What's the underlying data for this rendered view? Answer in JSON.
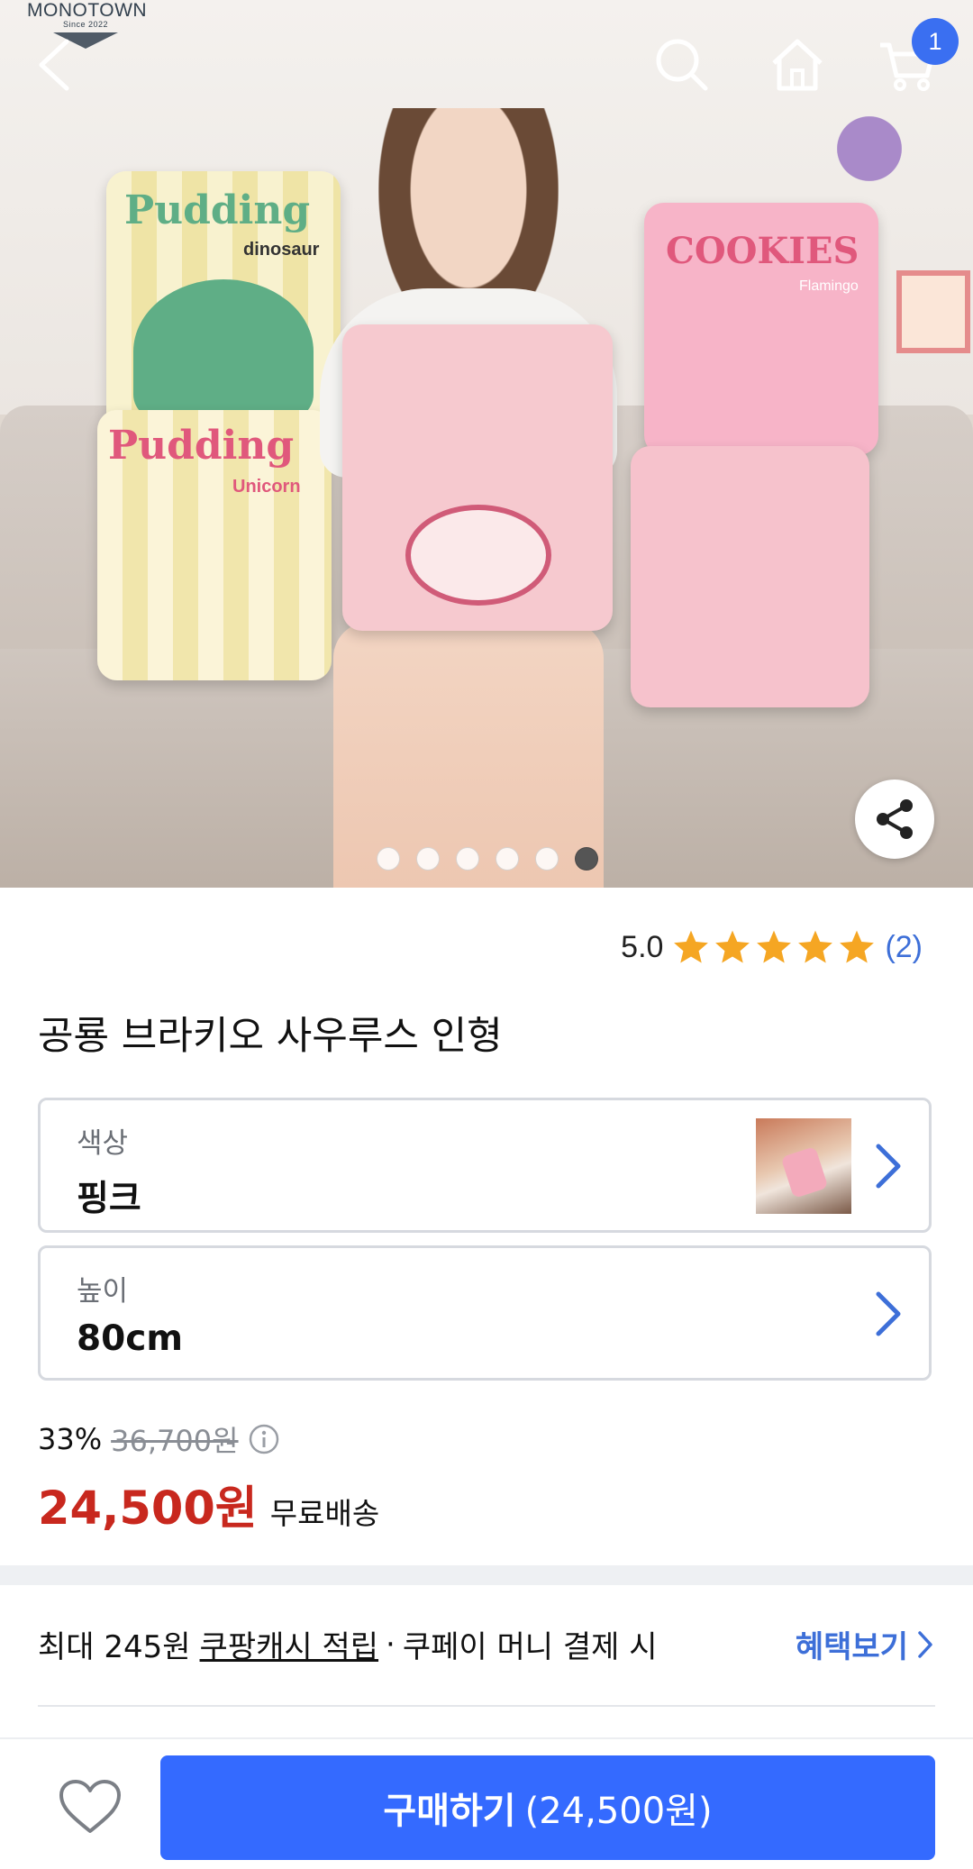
{
  "header": {
    "logo_text": "MONOTOWN",
    "logo_subtext": "Since 2022",
    "cart_count": "1"
  },
  "hero": {
    "slide_count": 6,
    "active_slide": 6,
    "pillow_labels": [
      "Pudding",
      "dinosaur",
      "Pudding",
      "Unicorn",
      "COOKIES",
      "Flamingo"
    ]
  },
  "rating": {
    "score": "5.0",
    "stars": 5,
    "count": "(2)"
  },
  "product": {
    "title": "공룡 브라키오 사우루스 인형"
  },
  "options": [
    {
      "label": "색상",
      "value": "핑크"
    },
    {
      "label": "높이",
      "value": "80cm"
    }
  ],
  "price": {
    "discount": "33%",
    "original": "36,700원",
    "sale": "24,500원",
    "shipping": "무료배송"
  },
  "cash": {
    "prefix": "최대 245원",
    "link": "쿠팡캐시 적립",
    "separator": "·",
    "suffix": "쿠페이 머니 결제 시",
    "benefit_label": "혜택보기"
  },
  "bottom": {
    "buy_label": "구매하기",
    "buy_price": "(24,500원)"
  },
  "colors": {
    "accent_blue": "#346aff",
    "sale_red": "#c8281e",
    "link_blue": "#3d6fd8",
    "star_yellow": "#f5a623"
  }
}
